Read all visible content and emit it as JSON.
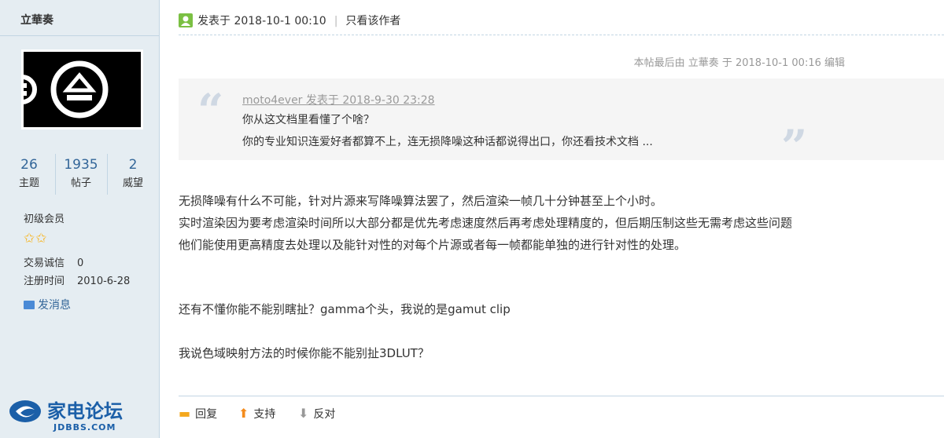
{
  "user": {
    "name": "立華奏",
    "stats": [
      {
        "num": "26",
        "label": "主题"
      },
      {
        "num": "1935",
        "label": "帖子"
      },
      {
        "num": "2",
        "label": "威望"
      }
    ],
    "group": "初级会员",
    "stars": "✩✩",
    "info": [
      {
        "key": "交易诚信",
        "val": "0"
      },
      {
        "key": "注册时间",
        "val": "2010-6-28"
      }
    ],
    "send_message": "发消息"
  },
  "logo": {
    "name": "家电论坛",
    "sub": "JDBBS.COM"
  },
  "post": {
    "posted": "发表于 2018-10-1 00:10",
    "only_author": "只看该作者",
    "edited": "本帖最后由 立華奏 于 2018-10-1 00:16 编辑",
    "quote": {
      "author": "moto4ever 发表于 2018-9-30 23:28",
      "line1": "你从这文档里看懂了个啥？",
      "line2": "你的专业知识连爱好者都算不上，连无损降噪这种话都说得出口，你还看技术文档 ..."
    },
    "body": [
      "无损降噪有什么不可能，针对片源来写降噪算法罢了，然后渲染一帧几十分钟甚至上个小时。",
      "实时渲染因为要考虑渲染时间所以大部分都是优先考虑速度然后再考虑处理精度的，但后期压制这些无需考虑这些问题",
      "他们能使用更高精度去处理以及能针对性的对每个片源或者每一帧都能单独的进行针对性的处理。",
      "还有不懂你能不能别瞎扯？gamma个头，我说的是gamut clip",
      "我说色域映射方法的时候你能不能别扯3DLUT？"
    ],
    "actions": {
      "reply": "回复",
      "support": "支持",
      "oppose": "反对"
    }
  }
}
